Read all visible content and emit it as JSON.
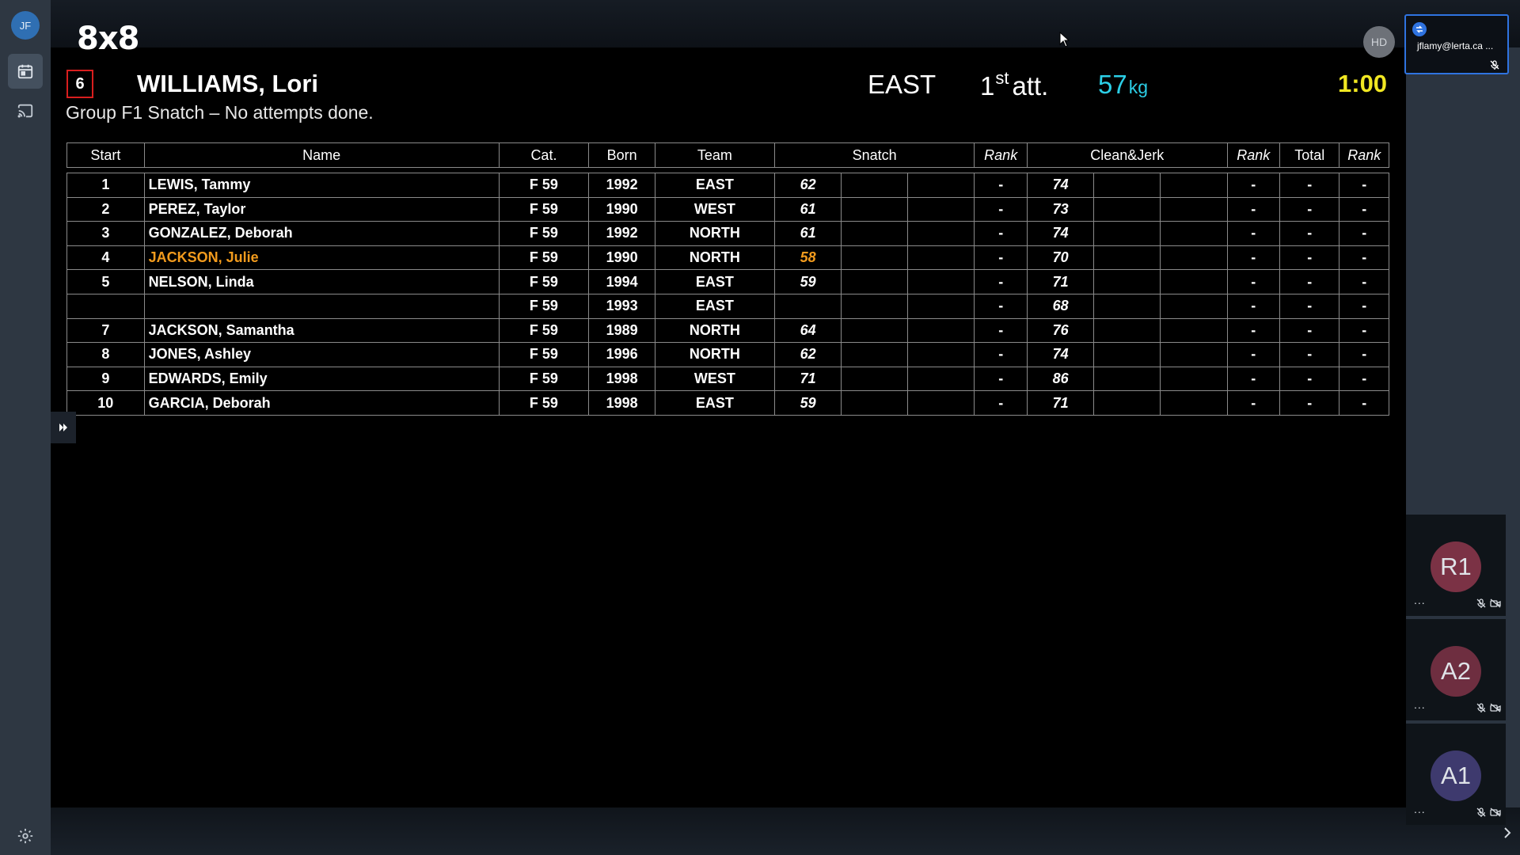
{
  "rail": {
    "avatar_initials": "JF",
    "icons": [
      "calendar-icon",
      "cast-icon",
      "gear-icon"
    ]
  },
  "scoreboard": {
    "logo": "8x8",
    "current_start": "6",
    "current_athlete": "WILLIAMS, Lori",
    "current_team": "EAST",
    "attempt_number": "1",
    "attempt_suffix": "st",
    "attempt_label": "att.",
    "requested_weight": "57",
    "weight_unit": "kg",
    "clock": "1:00",
    "group_status": "Group F1 Snatch – No attempts done.",
    "highlight_color": "#f29b1d",
    "weight_color": "#2ccfe7",
    "clock_color": "#f1e722",
    "columns": {
      "start": "Start",
      "name": "Name",
      "cat": "Cat.",
      "born": "Born",
      "team": "Team",
      "snatch": "Snatch",
      "snatch_rank": "Rank",
      "cj": "Clean&Jerk",
      "cj_rank": "Rank",
      "total": "Total",
      "total_rank": "Rank"
    },
    "rows": [
      {
        "start": "1",
        "name": "LEWIS, Tammy",
        "cat": "F 59",
        "born": "1992",
        "team": "EAST",
        "sn1": "62",
        "sn_rank": "-",
        "cj1": "74",
        "cj_rank": "-",
        "total": "-",
        "total_rank": "-"
      },
      {
        "start": "2",
        "name": "PEREZ, Taylor",
        "cat": "F 59",
        "born": "1990",
        "team": "WEST",
        "sn1": "61",
        "sn_rank": "-",
        "cj1": "73",
        "cj_rank": "-",
        "total": "-",
        "total_rank": "-"
      },
      {
        "start": "3",
        "name": "GONZALEZ, Deborah",
        "cat": "F 59",
        "born": "1992",
        "team": "NORTH",
        "sn1": "61",
        "sn_rank": "-",
        "cj1": "74",
        "cj_rank": "-",
        "total": "-",
        "total_rank": "-"
      },
      {
        "start": "4",
        "name": "JACKSON, Julie",
        "cat": "F 59",
        "born": "1990",
        "team": "NORTH",
        "sn1": "58",
        "sn_rank": "-",
        "cj1": "70",
        "cj_rank": "-",
        "total": "-",
        "total_rank": "-"
      },
      {
        "start": "5",
        "name": "NELSON, Linda",
        "cat": "F 59",
        "born": "1994",
        "team": "EAST",
        "sn1": "59",
        "sn_rank": "-",
        "cj1": "71",
        "cj_rank": "-",
        "total": "-",
        "total_rank": "-"
      },
      {
        "start": "",
        "name": "",
        "cat": "F 59",
        "born": "1993",
        "team": "EAST",
        "sn1": "",
        "sn_rank": "-",
        "cj1": "68",
        "cj_rank": "-",
        "total": "-",
        "total_rank": "-"
      },
      {
        "start": "7",
        "name": "JACKSON, Samantha",
        "cat": "F 59",
        "born": "1989",
        "team": "NORTH",
        "sn1": "64",
        "sn_rank": "-",
        "cj1": "76",
        "cj_rank": "-",
        "total": "-",
        "total_rank": "-"
      },
      {
        "start": "8",
        "name": "JONES, Ashley",
        "cat": "F 59",
        "born": "1996",
        "team": "NORTH",
        "sn1": "62",
        "sn_rank": "-",
        "cj1": "74",
        "cj_rank": "-",
        "total": "-",
        "total_rank": "-"
      },
      {
        "start": "9",
        "name": "EDWARDS, Emily",
        "cat": "F 59",
        "born": "1998",
        "team": "WEST",
        "sn1": "71",
        "sn_rank": "-",
        "cj1": "86",
        "cj_rank": "-",
        "total": "-",
        "total_rank": "-"
      },
      {
        "start": "10",
        "name": "GARCIA, Deborah",
        "cat": "F 59",
        "born": "1998",
        "team": "EAST",
        "sn1": "59",
        "sn_rank": "-",
        "cj1": "71",
        "cj_rank": "-",
        "total": "-",
        "total_rank": "-"
      }
    ]
  },
  "participants": {
    "host_initials": "HD",
    "self_email": "jflamy@lerta.ca ...",
    "tiles": [
      {
        "initials": "R1",
        "color": "#7b3245",
        "menu": "..."
      },
      {
        "initials": "A2",
        "color": "#6e2e40",
        "menu": "..."
      },
      {
        "initials": "A1",
        "color": "#3e3a6e",
        "menu": "..."
      }
    ]
  }
}
